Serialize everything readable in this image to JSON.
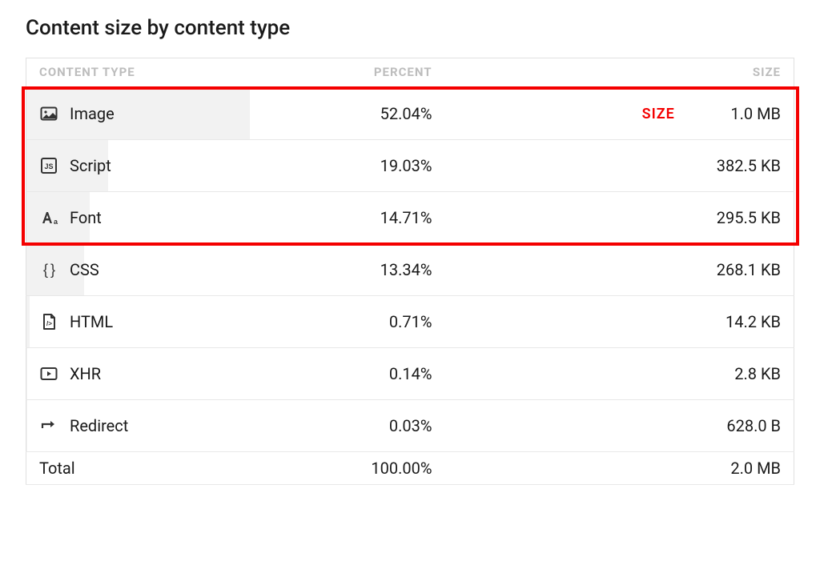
{
  "title": "Content size by content type",
  "columns": {
    "type": "CONTENT TYPE",
    "percent": "PERCENT",
    "size": "SIZE"
  },
  "rows": [
    {
      "icon": "image-icon",
      "label": "Image",
      "percent": "52.04%",
      "size": "1.0 MB",
      "bar": 52.04
    },
    {
      "icon": "script-icon",
      "label": "Script",
      "percent": "19.03%",
      "size": "382.5 KB",
      "bar": 19.03
    },
    {
      "icon": "font-icon",
      "label": "Font",
      "percent": "14.71%",
      "size": "295.5 KB",
      "bar": 14.71
    },
    {
      "icon": "css-icon",
      "label": "CSS",
      "percent": "13.34%",
      "size": "268.1 KB",
      "bar": 13.34
    },
    {
      "icon": "html-icon",
      "label": "HTML",
      "percent": "0.71%",
      "size": "14.2 KB",
      "bar": 0.71
    },
    {
      "icon": "xhr-icon",
      "label": "XHR",
      "percent": "0.14%",
      "size": "2.8 KB",
      "bar": 0.14
    },
    {
      "icon": "redirect-icon",
      "label": "Redirect",
      "percent": "0.03%",
      "size": "628.0 B",
      "bar": 0.03
    }
  ],
  "total": {
    "label": "Total",
    "percent": "100.00%",
    "size": "2.0 MB"
  },
  "annotation": {
    "label": "SIZE"
  },
  "chart_data": {
    "type": "table",
    "title": "Content size by content type",
    "columns": [
      "Content Type",
      "Percent",
      "Size"
    ],
    "rows": [
      [
        "Image",
        52.04,
        "1.0 MB"
      ],
      [
        "Script",
        19.03,
        "382.5 KB"
      ],
      [
        "Font",
        14.71,
        "295.5 KB"
      ],
      [
        "CSS",
        13.34,
        "268.1 KB"
      ],
      [
        "HTML",
        0.71,
        "14.2 KB"
      ],
      [
        "XHR",
        0.14,
        "2.8 KB"
      ],
      [
        "Redirect",
        0.03,
        "628.0 B"
      ],
      [
        "Total",
        100.0,
        "2.0 MB"
      ]
    ]
  }
}
